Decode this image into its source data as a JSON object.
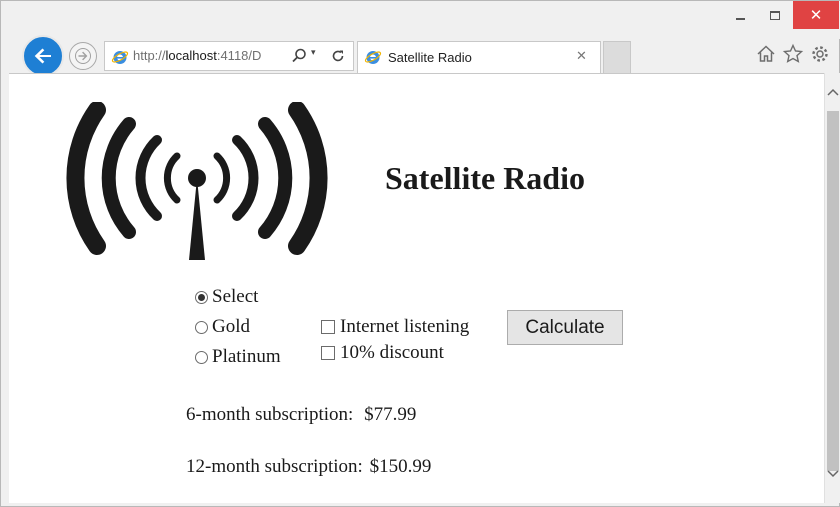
{
  "browser": {
    "window_controls": {
      "minimize": "–",
      "maximize": "□",
      "close": "✕"
    },
    "address_bar": {
      "url_prefix": "http://",
      "url_host": "localhost",
      "url_rest": ":4118/D",
      "dropdown": "▾"
    },
    "tab": {
      "title": "Satellite Radio",
      "close": "✕"
    },
    "icons": [
      "back-arrow-icon",
      "forward-arrow-icon",
      "ie-logo-icon",
      "search-icon",
      "refresh-icon",
      "home-icon",
      "star-icon",
      "gear-icon"
    ]
  },
  "page": {
    "title": "Satellite Radio",
    "plan_options": [
      {
        "label": "Select",
        "checked": true
      },
      {
        "label": "Gold",
        "checked": false
      },
      {
        "label": "Platinum",
        "checked": false
      }
    ],
    "extras": [
      {
        "label": "Internet listening",
        "checked": false
      },
      {
        "label": "10% discount",
        "checked": false
      }
    ],
    "calculate_label": "Calculate",
    "results": {
      "six_month_label": "6-month subscription:",
      "six_month_value": "$77.99",
      "twelve_month_label": "12-month subscription:",
      "twelve_month_value": "$150.99"
    }
  },
  "colors": {
    "back_button": "#1e7fd4",
    "close_button": "#e04343",
    "logo": "#1a1a1a"
  }
}
